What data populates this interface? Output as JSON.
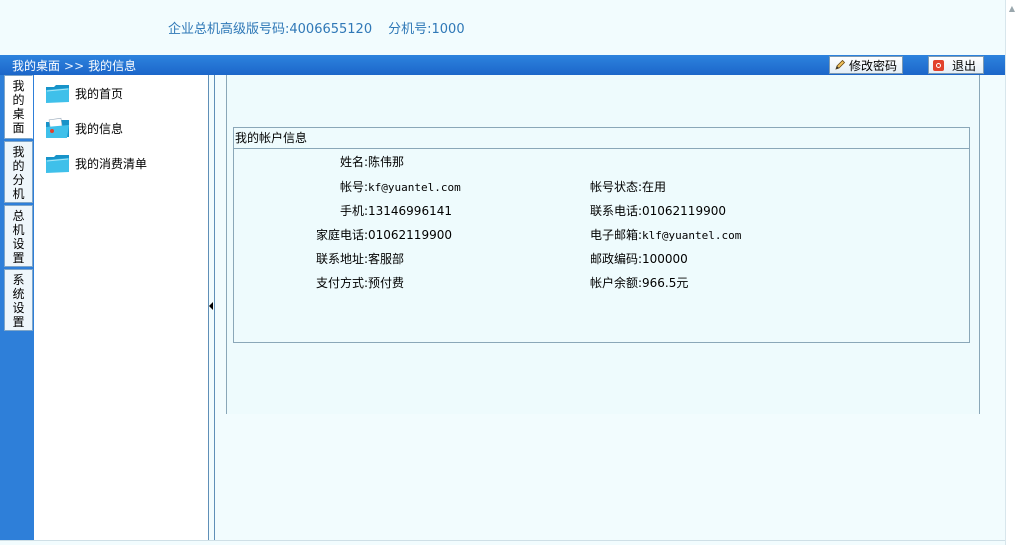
{
  "header": {
    "hotline_label": "企业总机高级版号码:",
    "hotline_number": "4006655120",
    "ext_label": "分机号:",
    "ext_number": "1000"
  },
  "navbar": {
    "breadcrumb_home": "我的桌面",
    "breadcrumb_sep": ">>",
    "breadcrumb_current": "我的信息",
    "change_password_label": "修改密码",
    "logout_label": "退出"
  },
  "tabs": [
    {
      "label": "我的桌面"
    },
    {
      "label": "我的分机"
    },
    {
      "label": "总机设置"
    },
    {
      "label": "系统设置"
    }
  ],
  "tree": [
    {
      "label": "我的首页",
      "icon": "folder-icon"
    },
    {
      "label": "我的信息",
      "icon": "folder-open-icon"
    },
    {
      "label": "我的消费清单",
      "icon": "folder-icon"
    }
  ],
  "account": {
    "title": "我的帐户信息",
    "name_label": "姓名:",
    "name": "陈伟那",
    "account_label": "帐号:",
    "account": "kf@yuantel.com",
    "status_label": "帐号状态:",
    "status": "在用",
    "mobile_label": "手机:",
    "mobile": "13146996141",
    "contact_phone_label": "联系电话:",
    "contact_phone": "01062119900",
    "home_phone_label": "家庭电话:",
    "home_phone": "01062119900",
    "email_label": "电子邮箱:",
    "email": "klf@yuantel.com",
    "address_label": "联系地址:",
    "address": "客服部",
    "zip_label": "邮政编码:",
    "zip": "100000",
    "payment_label": "支付方式:",
    "payment": "预付费",
    "balance_label": "帐户余额:",
    "balance": "966.5元"
  },
  "colors": {
    "nav_blue": "#1c66c9",
    "header_text": "#2f78b7",
    "content_bg": "#eefbfd"
  }
}
